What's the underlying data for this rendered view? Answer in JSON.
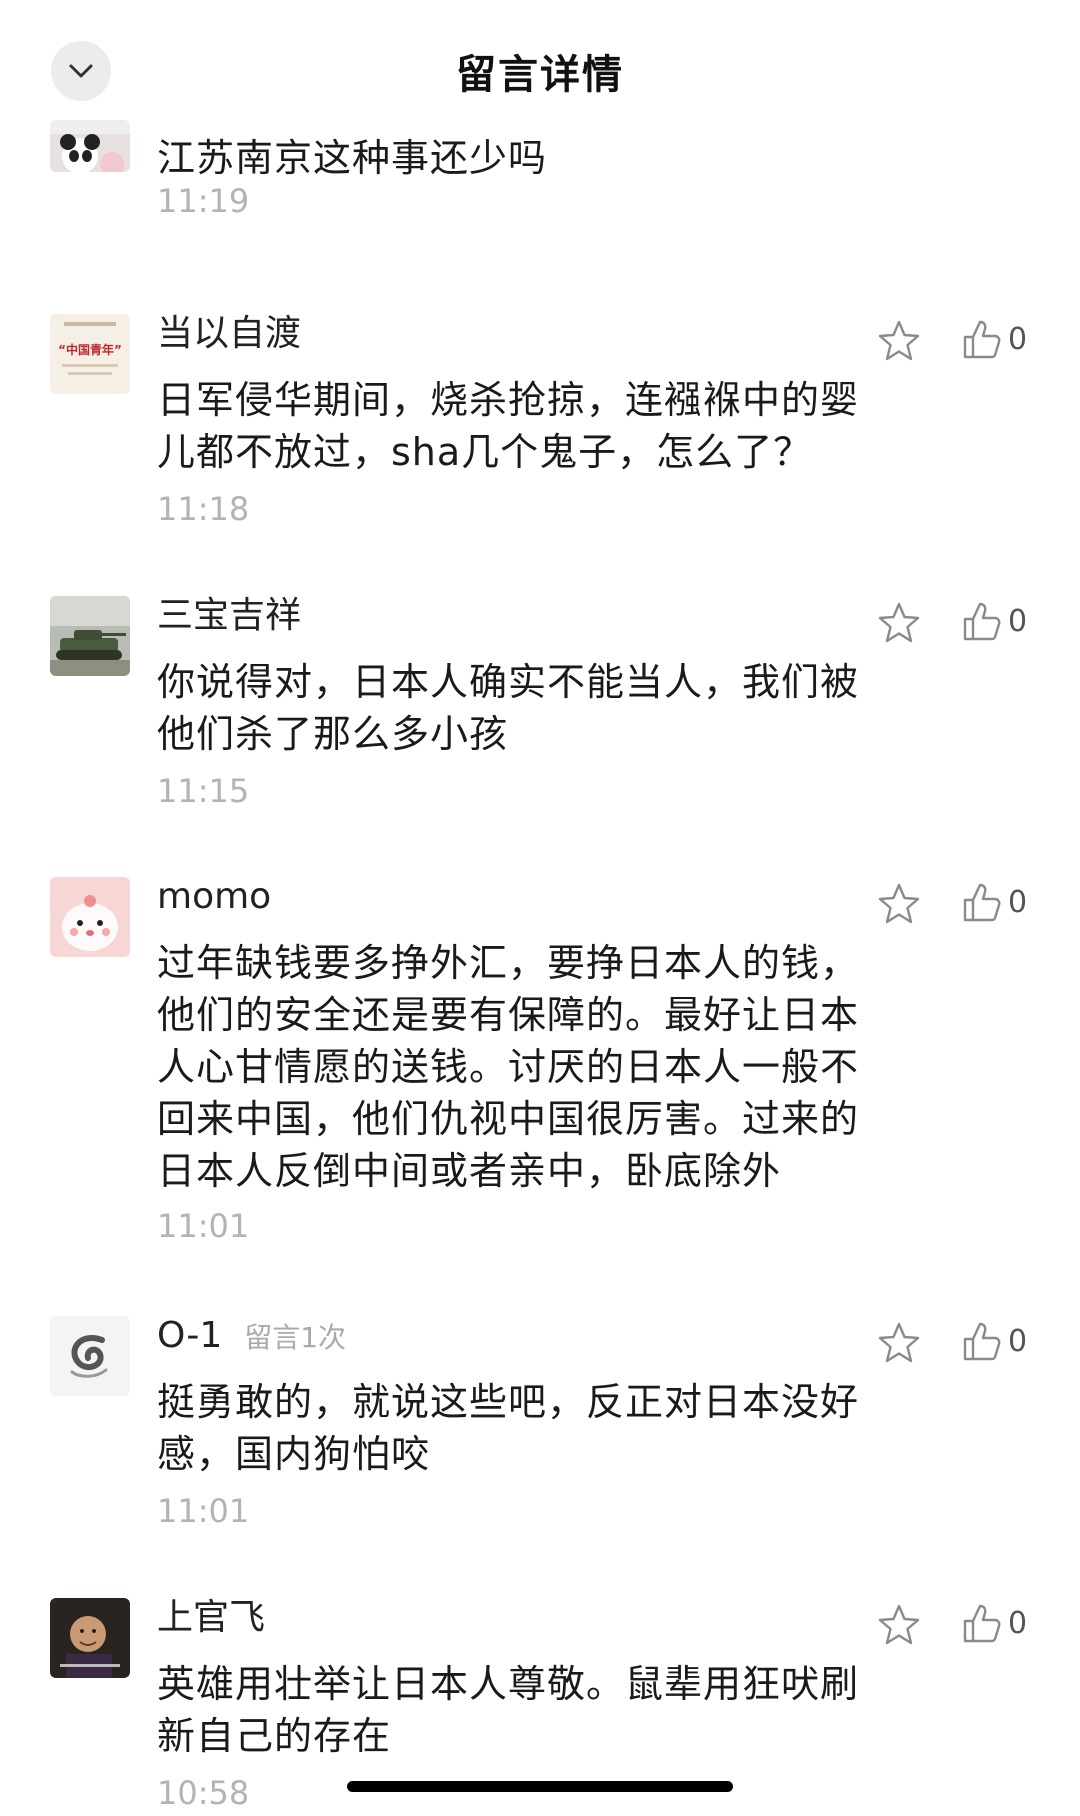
{
  "header": {
    "title": "留言详情",
    "back_icon": "chevron-down-icon"
  },
  "comments": [
    {
      "nickname": "",
      "text": "江苏南京这种事还少吗",
      "time": "11:19",
      "avatar": "panda-avatar"
    },
    {
      "nickname": "当以自渡",
      "text": "日军侵华期间，烧杀抢掠，连襁褓中的婴儿都不放过，sha几个鬼子，怎么了？",
      "time": "11:18",
      "likes": "0",
      "avatar": "china-youth-avatar",
      "avatar_text": "“中国青年”"
    },
    {
      "nickname": "三宝吉祥",
      "text": "你说得对，日本人确实不能当人，我们被他们杀了那么多小孩",
      "time": "11:15",
      "likes": "0",
      "avatar": "tank-avatar"
    },
    {
      "nickname": "momo",
      "text": "过年缺钱要多挣外汇，要挣日本人的钱，他们的安全还是要有保障的。最好让日本人心甘情愿的送钱。讨厌的日本人一般不回来中国，他们仇视中国很厉害。过来的日本人反倒中间或者亲中，卧底除外",
      "time": "11:01",
      "likes": "0",
      "avatar": "cartoon-avatar"
    },
    {
      "nickname": "O-1",
      "badge": "留言1次",
      "text": "挺勇敢的，就说这些吧，反正对日本没好感，国内狗怕咬",
      "time": "11:01",
      "likes": "0",
      "avatar": "ink-swirl-avatar"
    },
    {
      "nickname": "上官飞",
      "text": "英雄用壮举让日本人尊敬。鼠辈用狂吠刷新自己的存在",
      "time": "10:58",
      "likes": "0",
      "avatar": "photo-avatar"
    }
  ],
  "colors": {
    "time": "#b3b3b3",
    "badge": "#aaaaaa",
    "icon": "#8a8a8a"
  }
}
